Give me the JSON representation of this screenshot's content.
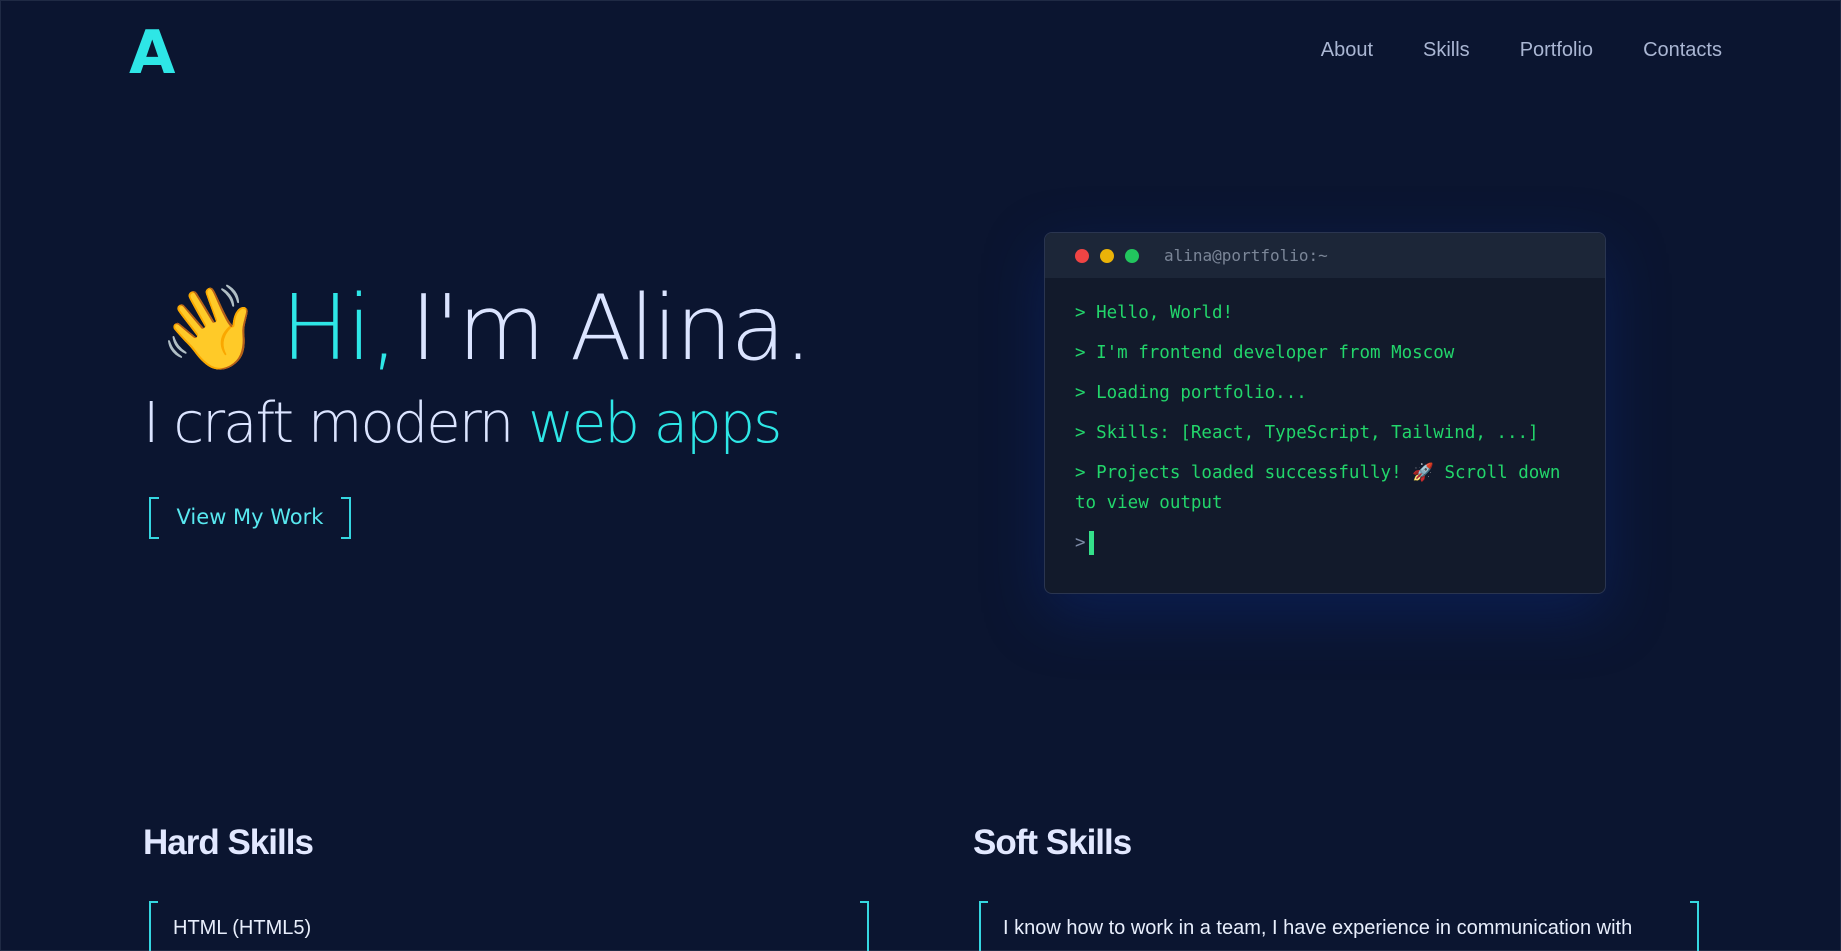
{
  "header": {
    "logo": "A",
    "nav": [
      "About",
      "Skills",
      "Portfolio",
      "Contacts"
    ]
  },
  "hero": {
    "wave_emoji": "👋",
    "greeting_hi": "Hi,",
    "greeting_name": "I'm Alina.",
    "tagline_prefix": "I craft modern",
    "tagline_accent": "web apps",
    "cta_label": "View My Work"
  },
  "terminal": {
    "title": "alina@portfolio:~",
    "lines": [
      "> Hello, World!",
      "> I'm frontend developer from Moscow",
      "> Loading portfolio...",
      "> Skills: [React, TypeScript, Tailwind, ...]",
      "> Projects loaded successfully! 🚀 Scroll down to view output"
    ],
    "prompt": ">"
  },
  "skills": {
    "hard_title": "Hard Skills",
    "hard_items": [
      "HTML (HTML5)"
    ],
    "soft_title": "Soft Skills",
    "soft_items": [
      "I know how to work in a team, I have experience in communication with"
    ]
  },
  "colors": {
    "background": "#0b1530",
    "accent": "#2ee6e6",
    "terminal_text": "#22d66b"
  }
}
